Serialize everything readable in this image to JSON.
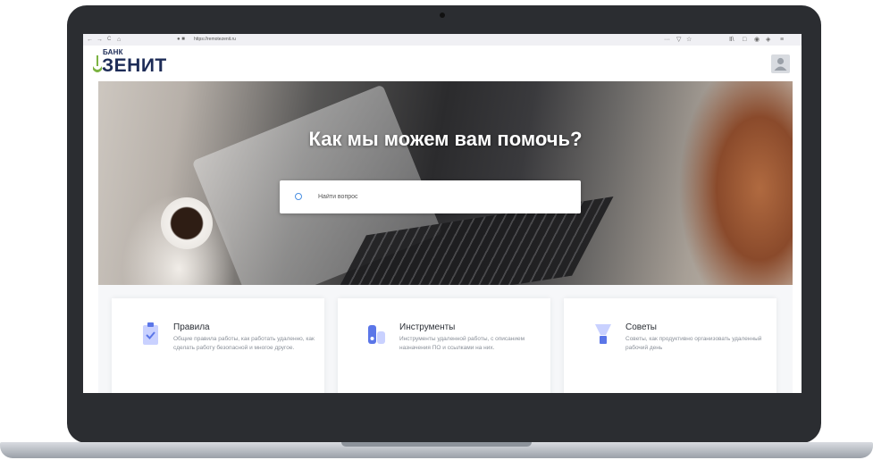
{
  "browser": {
    "back_icon": "←",
    "forward_icon": "→",
    "reload_icon": "C",
    "home_icon": "⌂",
    "url": "https://remotezenit.ru",
    "menu_dots": "···",
    "pocket_icon": "▽",
    "star_icon": "☆",
    "library_icon": "Ⅱ\\",
    "sidebar_icon": "□",
    "extension_icon": "◉",
    "account_icon": "◈",
    "hamburger_icon": "≡"
  },
  "header": {
    "logo_small": "БАНК",
    "logo_big": "ЗЕНИТ",
    "avatar_icon": "user-avatar-icon"
  },
  "hero": {
    "title": "Как мы можем вам помочь?",
    "search_placeholder": "Найти вопрос"
  },
  "cards": [
    {
      "icon": "clipboard-check-icon",
      "title": "Правила",
      "description": "Общие правила работы, как работать удаленно, как сделать работу безопасной и многое другое."
    },
    {
      "icon": "tools-icon",
      "title": "Инструменты",
      "description": "Инструменты удаленной работы, с описанием назначения ПО и ссылками на них."
    },
    {
      "icon": "lightbulb-icon",
      "title": "Советы",
      "description": "Советы, как продуктивно организовать удаленный рабочий день"
    }
  ],
  "colors": {
    "brand_navy": "#1d2c57",
    "brand_green": "#7cb342",
    "accent_blue": "#4a90e2",
    "icon_blue": "#5b76e8",
    "icon_lilac": "#c9d1ff"
  }
}
